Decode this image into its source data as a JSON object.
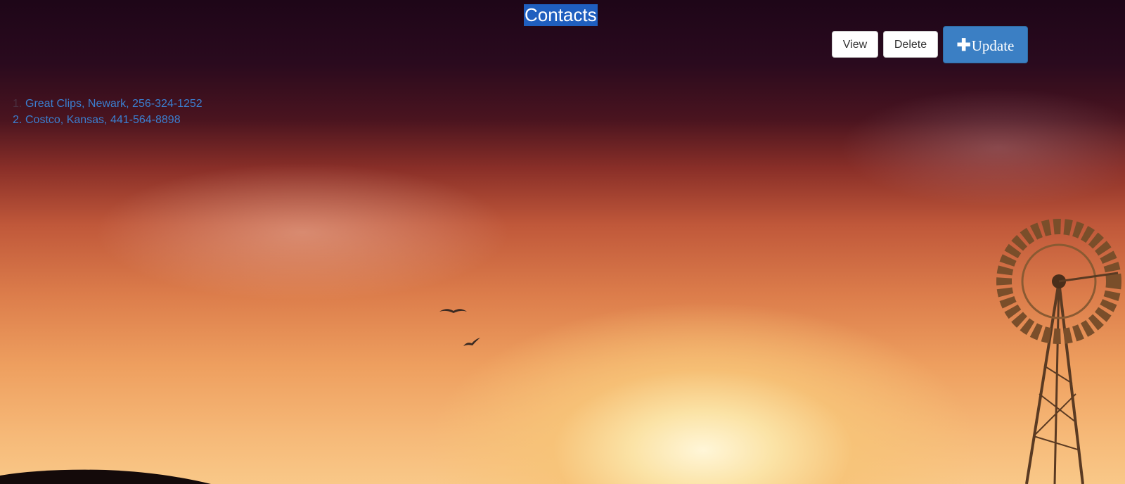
{
  "header": {
    "title": "Contacts"
  },
  "toolbar": {
    "view_label": "View",
    "delete_label": "Delete",
    "update_label": "Update",
    "update_icon": "plus-icon"
  },
  "contacts": [
    {
      "number": "1.",
      "text": "Great Clips, Newark, 256-324-1252"
    },
    {
      "number": "2.",
      "text": "Costco, Kansas, 441-564-8898"
    }
  ],
  "colors": {
    "title_highlight": "#1f5fbf",
    "update_button": "#3b7fc4",
    "link": "#3b7fd0"
  }
}
